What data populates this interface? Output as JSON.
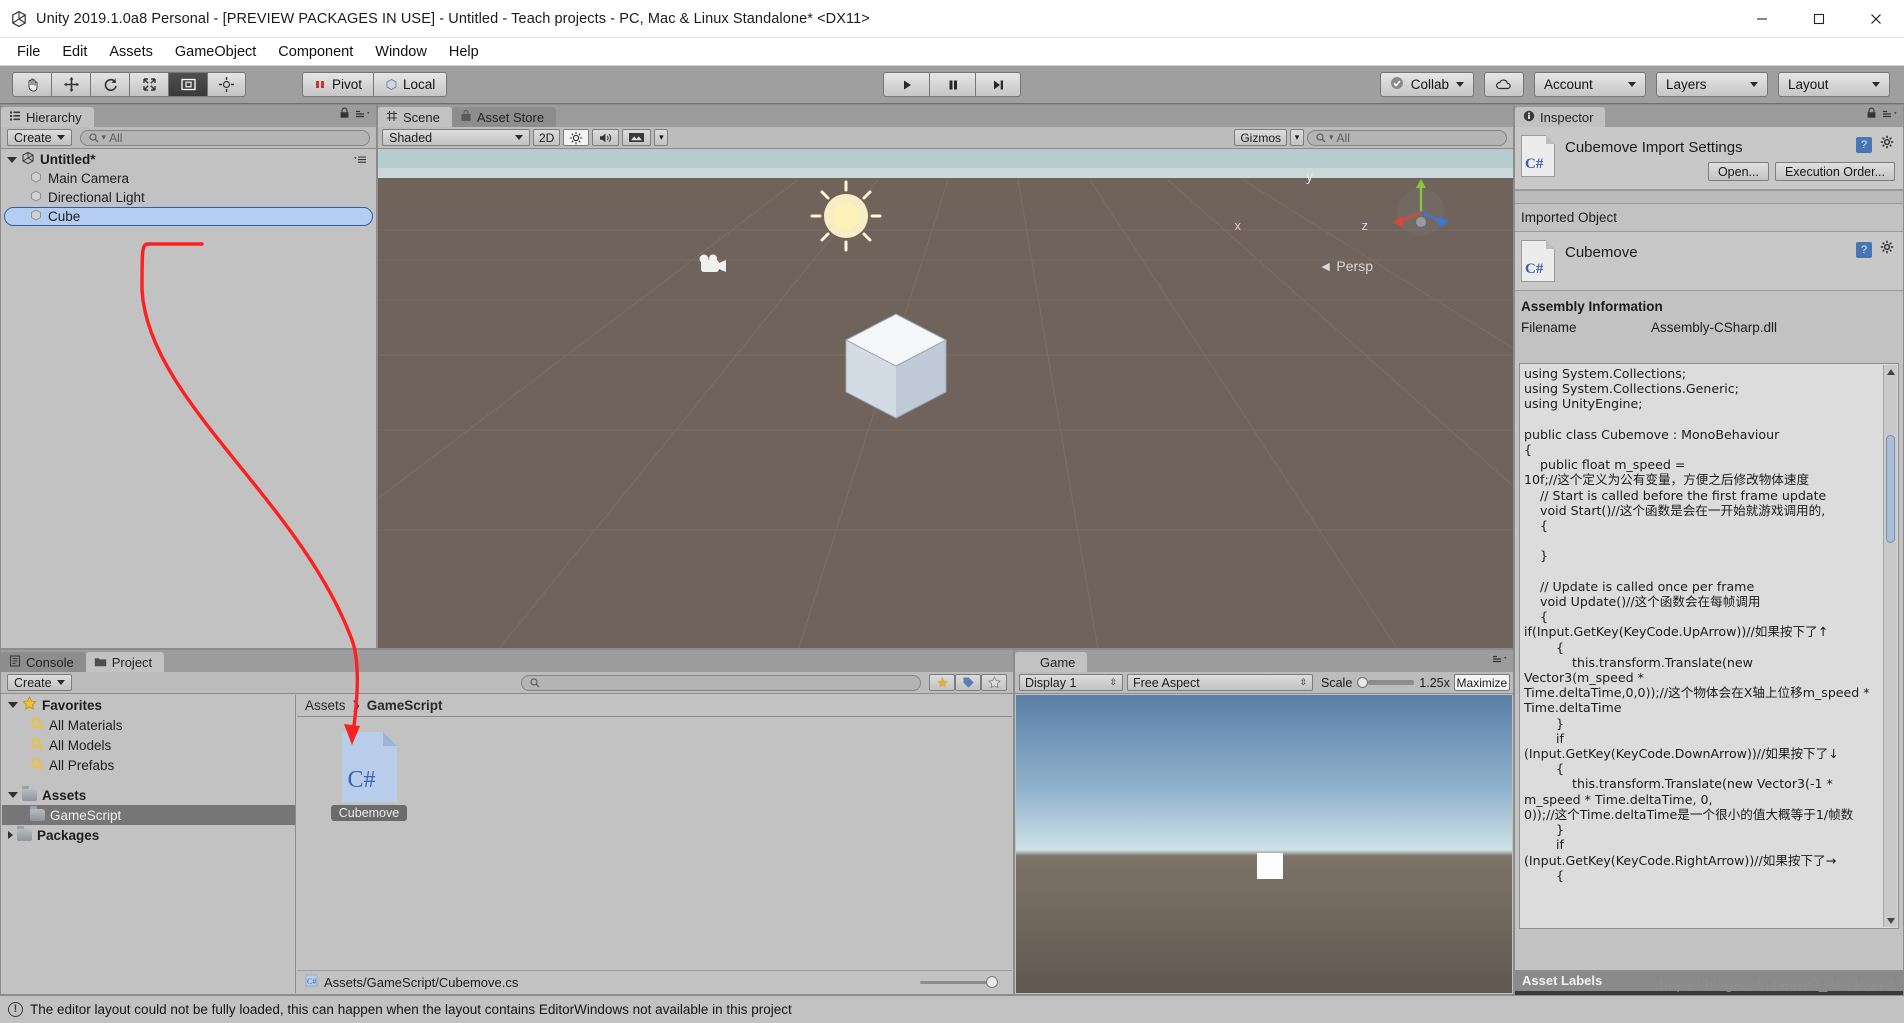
{
  "window": {
    "title": "Unity 2019.1.0a8 Personal - [PREVIEW PACKAGES IN USE] - Untitled - Teach projects - PC, Mac & Linux Standalone* <DX11>",
    "minimize_label": "minimize-icon",
    "maximize_label": "maximize-icon",
    "close_label": "close-icon"
  },
  "menubar": {
    "items": [
      "File",
      "Edit",
      "Assets",
      "GameObject",
      "Component",
      "Window",
      "Help"
    ]
  },
  "toolbar": {
    "transform_tools": [
      {
        "name": "hand-tool",
        "selected": false
      },
      {
        "name": "move-tool",
        "selected": false
      },
      {
        "name": "rotate-tool",
        "selected": false
      },
      {
        "name": "scale-tool",
        "selected": false
      },
      {
        "name": "rect-tool",
        "selected": true
      },
      {
        "name": "transform-tool",
        "selected": false
      }
    ],
    "pivot_label": "Pivot",
    "space_label": "Local",
    "play_label": "play-icon",
    "pause_label": "pause-icon",
    "step_label": "step-icon",
    "collab_label": "Collab",
    "cloud_label": "cloud-icon",
    "account_label": "Account",
    "layers_label": "Layers",
    "layout_label": "Layout"
  },
  "hierarchy": {
    "tab_label": "Hierarchy",
    "create_label": "Create",
    "search_placeholder": "All",
    "scene_name": "Untitled*",
    "items": [
      {
        "label": "Main Camera",
        "selected": false
      },
      {
        "label": "Directional Light",
        "selected": false
      },
      {
        "label": "Cube",
        "selected": true
      }
    ]
  },
  "scene": {
    "tabs": [
      {
        "label": "Scene",
        "active": true
      },
      {
        "label": "Asset Store",
        "active": false
      }
    ],
    "shading_mode": "Shaded",
    "mode_2d": "2D",
    "lighting_icon": "lighting-toggle-icon",
    "audio_icon": "audio-toggle-icon",
    "effects_icon": "effects-toggle-icon",
    "gizmos_label": "Gizmos",
    "search_placeholder": "All",
    "persp_label": "Persp",
    "axis_x": "x",
    "axis_y": "y",
    "axis_z": "z"
  },
  "inspector": {
    "tab_label": "Inspector",
    "importer_title": "Cubemove Import Settings",
    "open_button": "Open...",
    "execution_order_button": "Execution Order...",
    "imported_object_label": "Imported Object",
    "object_name": "Cubemove",
    "assembly_section": "Assembly Information",
    "filename_key": "Filename",
    "filename_value": "Assembly-CSharp.dll",
    "code": "using System.Collections;\nusing System.Collections.Generic;\nusing UnityEngine;\n\npublic class Cubemove : MonoBehaviour\n{\n    public float m_speed =\n10f;//这个定义为公有变量，方便之后修改物体速度\n    // Start is called before the first frame update\n    void Start()//这个函数是会在一开始就游戏调用的,\n    {\n\n    }\n\n    // Update is called once per frame\n    void Update()//这个函数会在每帧调用\n    {\nif(Input.GetKey(KeyCode.UpArrow))//如果按下了↑\n        {\n            this.transform.Translate(new\nVector3(m_speed *\nTime.deltaTime,0,0));//这个物体会在X轴上位移m_speed * Time.deltaTime\n        }\n        if\n(Input.GetKey(KeyCode.DownArrow))//如果按下了↓\n        {\n            this.transform.Translate(new Vector3(-1 * m_speed * Time.deltaTime, 0,\n0));//这个Time.deltaTime是一个很小的值大概等于1/帧数\n        }\n        if\n(Input.GetKey(KeyCode.RightArrow))//如果按下了→\n        {",
    "asset_labels_title": "Asset Labels"
  },
  "project": {
    "tabs": [
      {
        "label": "Console",
        "active": false
      },
      {
        "label": "Project",
        "active": true
      }
    ],
    "create_label": "Create",
    "search_placeholder": "",
    "tree": [
      {
        "label": "Favorites",
        "type": "favorites",
        "depth": 0,
        "expanded": true,
        "bold": true,
        "selected": false
      },
      {
        "label": "All Materials",
        "type": "search",
        "depth": 1,
        "bold": false,
        "selected": false
      },
      {
        "label": "All Models",
        "type": "search",
        "depth": 1,
        "bold": false,
        "selected": false
      },
      {
        "label": "All Prefabs",
        "type": "search",
        "depth": 1,
        "bold": false,
        "selected": false
      },
      {
        "label": "Assets",
        "type": "folder",
        "depth": 0,
        "expanded": true,
        "bold": true,
        "selected": false
      },
      {
        "label": "GameScript",
        "type": "folder",
        "depth": 1,
        "bold": false,
        "selected": true
      },
      {
        "label": "Packages",
        "type": "folder",
        "depth": 0,
        "expanded": false,
        "bold": true,
        "selected": false
      }
    ],
    "breadcrumb": [
      "Assets",
      "GameScript"
    ],
    "asset_name": "Cubemove",
    "asset_kind": "C#",
    "status_path": "Assets/GameScript/Cubemove.cs"
  },
  "game": {
    "tab_label": "Game",
    "display_label": "Display 1",
    "aspect_label": "Free Aspect",
    "scale_label": "Scale",
    "scale_value": "1.25x",
    "maximize_label": "Maximize"
  },
  "statusbar": {
    "message": "The editor layout could not be fully loaded, this can happen when the layout contains EditorWindows not available in this project"
  },
  "watermark": "https://blog.csdn.net/m0_46210273",
  "colors": {
    "selection_blue": "#b5cdf0",
    "annotation_red": "#fc2020",
    "panel_gray": "#c2c2c2",
    "toolbar_gray": "#9f9f9f"
  }
}
